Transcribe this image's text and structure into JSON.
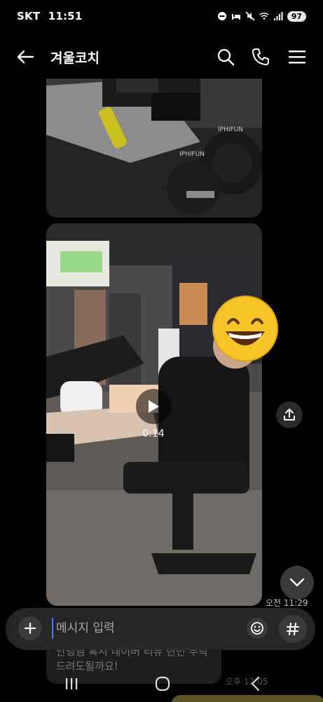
{
  "status_bar": {
    "carrier": "SKT",
    "time": "11:51",
    "battery": "97",
    "icons": [
      "minus-circle-icon",
      "bed-icon",
      "mute-icon",
      "wifi-icon",
      "signal-icon",
      "battery-icon"
    ]
  },
  "header": {
    "title": "겨울코치",
    "icons": [
      "back-arrow-icon",
      "search-icon",
      "phone-icon",
      "menu-icon"
    ]
  },
  "messages": {
    "video": {
      "duration": "0:14",
      "time": "오전 11:29"
    },
    "partially_hidden_text": "안녕님 혹시 네이버 리뷰 한번 부탁드려도될까요!",
    "partially_hidden_time": "오후 12:05"
  },
  "input": {
    "placeholder": "메시지 입력"
  },
  "nav": {
    "icons": [
      "recent-apps-icon",
      "home-icon",
      "back-icon"
    ]
  },
  "colors": {
    "background": "#000000",
    "input_bar": "#282828",
    "cursor": "#4a7cff"
  }
}
